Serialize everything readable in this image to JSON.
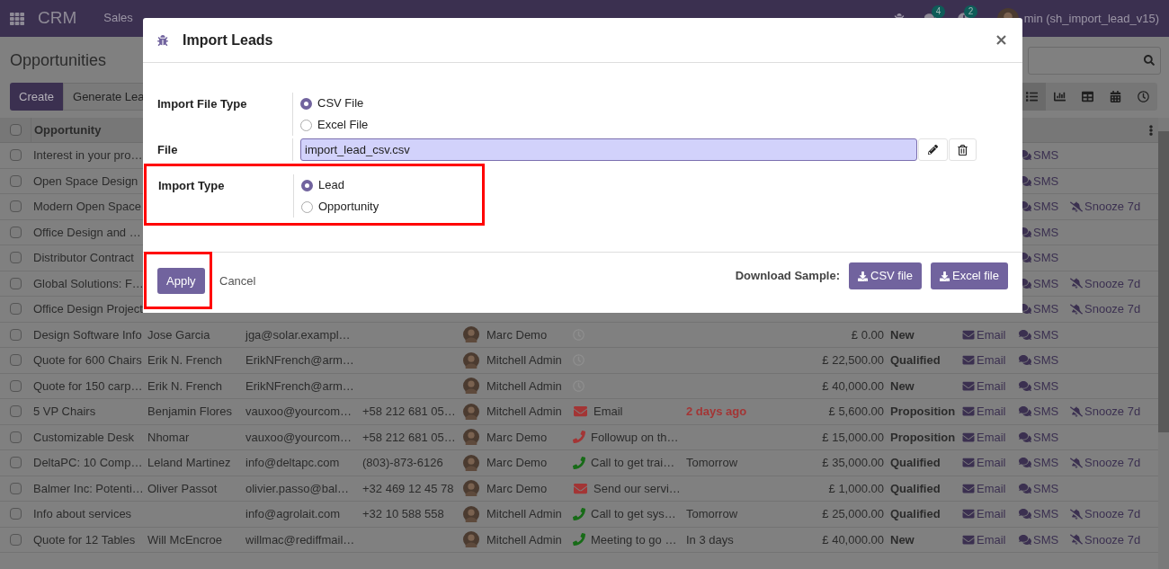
{
  "navbar": {
    "app": "CRM",
    "menus": [
      "Sales"
    ],
    "chat_badge": "4",
    "activity_badge": "2",
    "user": "min (sh_import_lead_v15)"
  },
  "control_panel": {
    "title": "Opportunities",
    "create": "Create",
    "generate": "Generate Lea",
    "views": [
      {
        "kind": "list",
        "selected": true
      },
      {
        "kind": "graph",
        "selected": false
      },
      {
        "kind": "pivot",
        "selected": false
      },
      {
        "kind": "calendar",
        "selected": false
      },
      {
        "kind": "activity",
        "selected": false
      }
    ]
  },
  "table": {
    "header_checked": false,
    "columns": [
      "Opportunity"
    ],
    "rows": [
      {
        "checked": false,
        "opportunity": "Interest in your pro…",
        "sms": "SMS"
      },
      {
        "checked": false,
        "opportunity": "Open Space Design",
        "sms": "SMS"
      },
      {
        "checked": false,
        "opportunity": "Modern Open Space",
        "sms": "SMS",
        "snooze": "Snooze 7d"
      },
      {
        "checked": false,
        "opportunity": "Office Design and …",
        "sms": "SMS"
      },
      {
        "checked": false,
        "opportunity": "Distributor Contract",
        "sms": "SMS"
      },
      {
        "checked": false,
        "opportunity": "Global Solutions: F…",
        "sms": "SMS",
        "snooze": "Snooze 7d"
      },
      {
        "checked": false,
        "opportunity": "Office Design Project",
        "sms": "SMS",
        "snooze": "Snooze 7d"
      },
      {
        "checked": false,
        "opportunity": "Design Software Info",
        "contact": "Jose Garcia",
        "email": "jga@solar.exampl…",
        "salesperson": "Marc Demo",
        "activity": {
          "kind": "none"
        },
        "revenue": "£ 0.00",
        "stage": "New",
        "email_button": "Email",
        "sms": "SMS"
      },
      {
        "checked": false,
        "opportunity": "Quote for 600 Chairs",
        "contact": "Erik N. French",
        "email": "ErikNFrench@arm…",
        "salesperson": "Mitchell Admin",
        "activity": {
          "kind": "none"
        },
        "revenue": "£ 22,500.00",
        "stage": "Qualified",
        "email_button": "Email",
        "sms": "SMS"
      },
      {
        "checked": false,
        "opportunity": "Quote for 150 carp…",
        "contact": "Erik N. French",
        "email": "ErikNFrench@arm…",
        "salesperson": "Mitchell Admin",
        "activity": {
          "kind": "none"
        },
        "revenue": "£ 40,000.00",
        "stage": "New",
        "email_button": "Email",
        "sms": "SMS"
      },
      {
        "checked": false,
        "opportunity": "5 VP Chairs",
        "contact": "Benjamin Flores",
        "email": "vauxoo@yourcom…",
        "phone": "+58 212 681 05…",
        "salesperson": "Mitchell Admin",
        "activity": {
          "kind": "email",
          "color": "#a33535",
          "summary": "Email"
        },
        "deadline": "2 days ago",
        "overdue": true,
        "revenue": "£ 5,600.00",
        "stage": "Proposition",
        "email_button": "Email",
        "sms": "SMS",
        "snooze": "Snooze 7d"
      },
      {
        "checked": false,
        "opportunity": "Customizable Desk",
        "contact": "Nhomar",
        "email": "vauxoo@yourcom…",
        "phone": "+58 212 681 05…",
        "salesperson": "Marc Demo",
        "activity": {
          "kind": "phone",
          "color": "#a33535",
          "summary": "Followup on th…"
        },
        "revenue": "£ 15,000.00",
        "stage": "Proposition",
        "email_button": "Email",
        "sms": "SMS"
      },
      {
        "checked": false,
        "opportunity": "DeltaPC: 10 Comp…",
        "contact": "Leland Martinez",
        "email": "info@deltapc.com",
        "phone": "(803)-873-6126",
        "salesperson": "Marc Demo",
        "activity": {
          "kind": "phone",
          "color": "#176b17",
          "summary": "Call to get trai…"
        },
        "deadline": "Tomorrow",
        "overdue": false,
        "revenue": "£ 35,000.00",
        "stage": "Qualified",
        "email_button": "Email",
        "sms": "SMS",
        "snooze": "Snooze 7d"
      },
      {
        "checked": false,
        "opportunity": "Balmer Inc: Potenti…",
        "contact": "Oliver Passot",
        "email": "olivier.passo@bal…",
        "phone": "+32 469 12 45 78",
        "salesperson": "Marc Demo",
        "activity": {
          "kind": "email",
          "color": "#a33535",
          "summary": "Send our servi…"
        },
        "revenue": "£ 1,000.00",
        "stage": "Qualified",
        "email_button": "Email",
        "sms": "SMS"
      },
      {
        "checked": false,
        "opportunity": "Info about services",
        "email": "info@agrolait.com",
        "phone": "+32 10 588 558",
        "salesperson": "Mitchell Admin",
        "activity": {
          "kind": "phone",
          "color": "#176b17",
          "summary": "Call to get sys…"
        },
        "deadline": "Tomorrow",
        "overdue": false,
        "revenue": "£ 25,000.00",
        "stage": "Qualified",
        "email_button": "Email",
        "sms": "SMS",
        "snooze": "Snooze 7d"
      },
      {
        "checked": false,
        "opportunity": "Quote for 12 Tables",
        "contact": "Will McEncroe",
        "email": "willmac@rediffmail…",
        "salesperson": "Mitchell Admin",
        "activity": {
          "kind": "phone",
          "color": "#176b17",
          "summary": "Meeting to go …"
        },
        "deadline": "In 3 days",
        "overdue": false,
        "revenue": "£ 40,000.00",
        "stage": "New",
        "email_button": "Email",
        "sms": "SMS",
        "snooze": "Snooze 7d"
      }
    ]
  },
  "dialog": {
    "title": "Import Leads",
    "fields": [
      {
        "kind": "radio",
        "label": "Import File Type",
        "highlighted": false,
        "options": [
          {
            "label": "CSV File",
            "selected": true
          },
          {
            "label": "Excel File",
            "selected": false
          }
        ]
      },
      {
        "kind": "file",
        "label": "File",
        "highlighted": false,
        "value": "import_lead_csv.csv"
      },
      {
        "kind": "radio",
        "label": "Import Type",
        "highlighted": true,
        "options": [
          {
            "label": "Lead",
            "selected": true
          },
          {
            "label": "Opportunity",
            "selected": false
          }
        ]
      }
    ],
    "apply": {
      "label": "Apply",
      "highlighted": true
    },
    "cancel": "Cancel",
    "download_label": "Download Sample:",
    "downloads": [
      "CSV file",
      "Excel file"
    ]
  }
}
